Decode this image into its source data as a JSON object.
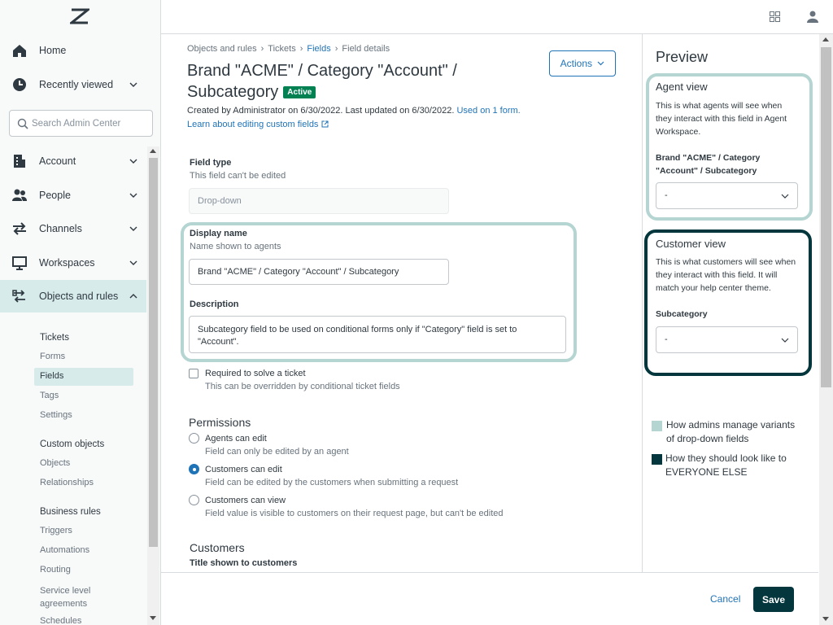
{
  "sidebar": {
    "nav": [
      {
        "label": "Home"
      },
      {
        "label": "Recently viewed"
      },
      {
        "label": "Account"
      },
      {
        "label": "People"
      },
      {
        "label": "Channels"
      },
      {
        "label": "Workspaces"
      },
      {
        "label": "Objects and rules"
      }
    ],
    "search_placeholder": "Search Admin Center",
    "sections": [
      {
        "title": "Tickets",
        "items": [
          "Forms",
          "Fields",
          "Tags",
          "Settings"
        ]
      },
      {
        "title": "Custom objects",
        "items": [
          "Objects",
          "Relationships"
        ]
      },
      {
        "title": "Business rules",
        "items": [
          "Triggers",
          "Automations",
          "Routing",
          "Service level agreements",
          "Schedules"
        ]
      }
    ]
  },
  "breadcrumb": [
    "Objects and rules",
    "Tickets",
    "Fields",
    "Field details"
  ],
  "page": {
    "title": "Brand \"ACME\" / Category \"Account\" / Subcategory",
    "status": "Active",
    "created": "Created by Administrator on 6/30/2022. Last updated on 6/30/2022.",
    "used_on": "Used on 1 form.",
    "learn_link": "Learn about editing custom fields",
    "actions_label": "Actions"
  },
  "form": {
    "field_type_label": "Field type",
    "field_type_hint": "This field can't be edited",
    "field_type_value": "Drop-down",
    "display_name_label": "Display name",
    "display_name_hint": "Name shown to agents",
    "display_name_value": "Brand \"ACME\" / Category \"Account\" / Subcategory",
    "description_label": "Description",
    "description_value": "Subcategory field to be used on conditional forms only if \"Category\" field is set to \"Account\".",
    "required_label": "Required to solve a ticket",
    "required_hint": "This can be overridden by conditional ticket fields",
    "permissions_heading": "Permissions",
    "permissions": [
      {
        "label": "Agents can edit",
        "hint": "Field can only be edited by an agent"
      },
      {
        "label": "Customers can edit",
        "hint": "Field can be edited by the customers when submitting a request"
      },
      {
        "label": "Customers can view",
        "hint": "Field value is visible to customers on their request page, but can't be edited"
      }
    ],
    "customers_heading": "Customers",
    "customers_title_label": "Title shown to customers"
  },
  "footer": {
    "cancel": "Cancel",
    "save": "Save"
  },
  "preview": {
    "title": "Preview",
    "agent": {
      "heading": "Agent view",
      "desc": "This is what agents will see when they interact with this field in Agent Workspace.",
      "field_label": "Brand \"ACME\" / Category \"Account\" / Subcategory",
      "select_value": "-"
    },
    "customer": {
      "heading": "Customer view",
      "desc": "This is what customers will see when they interact with this field. It will match your help center theme.",
      "field_label": "Subcategory",
      "select_value": "-"
    }
  },
  "legend": [
    {
      "text": "How admins manage variants of drop-down fields",
      "color": "#b4d5d1"
    },
    {
      "text": "How they should look like to EVERYONE ELSE",
      "color": "#03363d"
    }
  ],
  "colors": {
    "accent": "#1f73b7",
    "brand": "#03363d",
    "active_badge": "#038153",
    "highlight_light": "#b4d5d1"
  }
}
